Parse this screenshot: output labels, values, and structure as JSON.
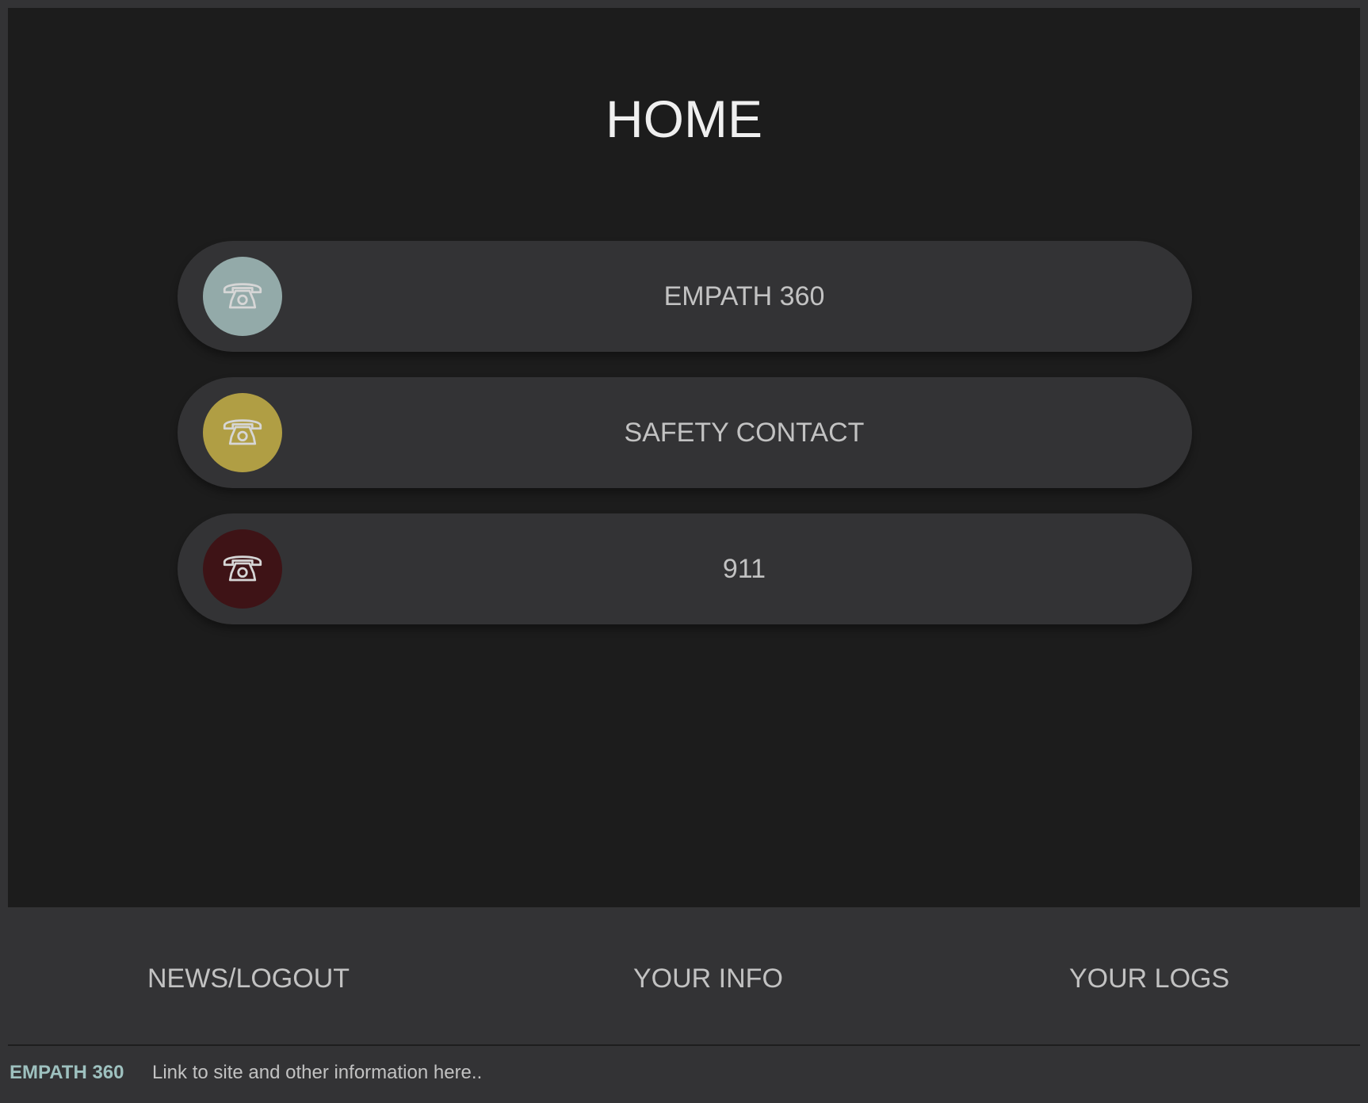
{
  "page": {
    "title": "HOME"
  },
  "contacts": [
    {
      "label": "EMPATH 360",
      "icon": "phone-icon",
      "color": "#93aaa9"
    },
    {
      "label": "SAFETY CONTACT",
      "icon": "phone-icon",
      "color": "#b09e44"
    },
    {
      "label": "911",
      "icon": "phone-icon",
      "color": "#3e1316"
    }
  ],
  "nav": {
    "news_logout": "NEWS/LOGOUT",
    "your_info": "YOUR INFO",
    "your_logs": "YOUR LOGS"
  },
  "footer": {
    "brand": "EMPATH 360",
    "link_text": "Link to site and other information here.."
  },
  "colors": {
    "background": "#1c1c1c",
    "panel": "#333335",
    "text": "#c2c2c2",
    "brand_accent": "#9ec1bf"
  }
}
